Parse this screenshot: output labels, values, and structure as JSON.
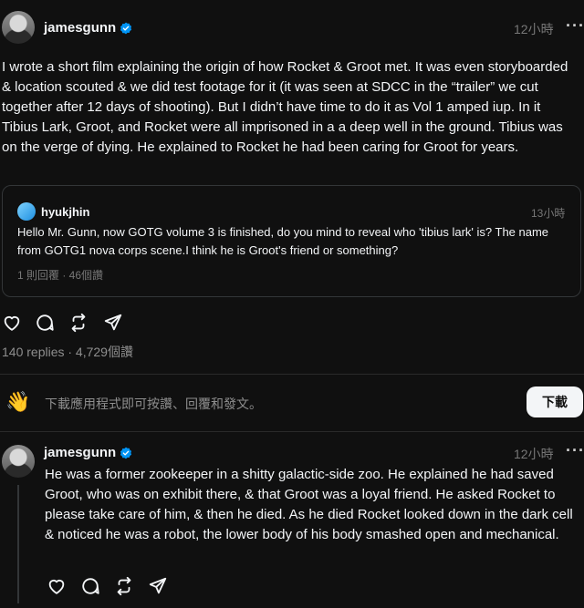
{
  "post1": {
    "username": "jamesgunn",
    "time": "12小時",
    "text": "I wrote a short film explaining the origin of how Rocket & Groot met. It was even storyboarded & location scouted & we did test footage for it (it was seen at SDCC in the “trailer” we cut together after 12 days of shooting). But I didn’t have time to do it as Vol 1 amped iup. In it Tibius Lark, Groot, and Rocket were all imprisoned in a a deep well in the ground. Tibius was on the verge of dying. He explained to Rocket he had been caring for Groot for years.",
    "quote": {
      "username": "hyukjhin",
      "time": "13小時",
      "text": "Hello Mr. Gunn, now GOTG volume 3 is finished, do you mind to reveal who 'tibius lark' is? The name from GOTG1 nova corps scene.I think he is Groot's friend or something?",
      "meta": "1 則回覆 · 46個讚"
    },
    "stats": "140 replies · 4,729個讚"
  },
  "banner": {
    "text": "下載應用程式即可按讚、回覆和發文。",
    "button": "下載"
  },
  "post2": {
    "username": "jamesgunn",
    "time": "12小時",
    "text": "He was a former zookeeper in a shitty galactic-side zoo. He explained he had saved Groot, who was on exhibit there, & that Groot was a loyal friend. He asked Rocket to please take care of him, & then he died. As he died Rocket looked down in the dark cell & noticed he was a robot, the lower body of his body smashed open and mechanical."
  },
  "icons": {
    "like": "heart-icon",
    "reply": "comment-icon",
    "repost": "repost-icon",
    "share": "send-icon",
    "more": "more-icon",
    "verified": "verified-badge-icon",
    "wave": "waving-hand-icon"
  },
  "colors": {
    "background": "#101010",
    "text": "#f3f5f7",
    "muted": "#777777",
    "verified": "#0095f6"
  }
}
